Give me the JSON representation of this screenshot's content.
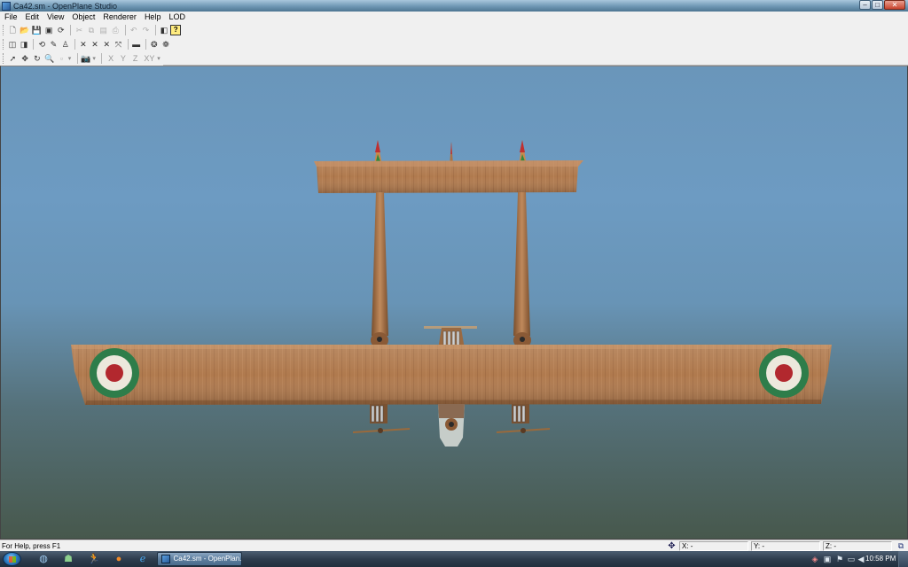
{
  "window": {
    "title": "Ca42.sm - OpenPlane Studio",
    "controls": {
      "minimize": "–",
      "maximize": "□",
      "close": "✕"
    }
  },
  "menubar": {
    "items": [
      "File",
      "Edit",
      "View",
      "Object",
      "Renderer",
      "Help",
      "LOD"
    ]
  },
  "toolbar": {
    "row1": [
      {
        "icon": "new-file-icon",
        "glyph": "🗋"
      },
      {
        "icon": "open-folder-icon",
        "glyph": "📂"
      },
      {
        "icon": "save-icon",
        "glyph": "💾"
      },
      {
        "icon": "save-all-icon",
        "glyph": "▣"
      },
      {
        "icon": "refresh-icon",
        "glyph": "⟳"
      },
      {
        "icon": "cut-icon",
        "glyph": "✂"
      },
      {
        "icon": "copy-icon",
        "glyph": "⧉"
      },
      {
        "icon": "paste-icon",
        "glyph": "▤"
      },
      {
        "icon": "print-icon",
        "glyph": "⎙"
      },
      {
        "icon": "undo-icon",
        "glyph": "↶"
      },
      {
        "icon": "redo-icon",
        "glyph": "↷"
      },
      {
        "icon": "properties-icon",
        "glyph": "◧"
      },
      {
        "icon": "help-icon",
        "glyph": "?"
      }
    ],
    "row2": [
      {
        "icon": "import-icon",
        "glyph": "◫"
      },
      {
        "icon": "export-icon",
        "glyph": "◨"
      },
      {
        "icon": "rotate-tool-icon",
        "glyph": "⟲"
      },
      {
        "icon": "paint-icon",
        "glyph": "✎"
      },
      {
        "icon": "stamp-icon",
        "glyph": "♙"
      },
      {
        "icon": "cross-x-icon",
        "glyph": "✕"
      },
      {
        "icon": "cross-y-icon",
        "glyph": "✕"
      },
      {
        "icon": "cross-z-icon",
        "glyph": "✕"
      },
      {
        "icon": "link-icon",
        "glyph": "⤧"
      },
      {
        "icon": "bar-icon",
        "glyph": "▬"
      },
      {
        "icon": "group-icon",
        "glyph": "❂"
      },
      {
        "icon": "ungroup-icon",
        "glyph": "❁"
      }
    ],
    "row3": [
      {
        "icon": "select-arrow-icon",
        "glyph": "➚"
      },
      {
        "icon": "move-icon",
        "glyph": "✥"
      },
      {
        "icon": "rotate-icon",
        "glyph": "↻"
      },
      {
        "icon": "zoom-icon",
        "glyph": "🔍"
      },
      {
        "icon": "scale-icon",
        "glyph": "▫"
      }
    ],
    "axes": [
      "X",
      "Y",
      "Z",
      "XY"
    ]
  },
  "statusbar": {
    "help_text": "For Help, press F1",
    "x_label": "X: -",
    "y_label": "Y: -",
    "z_label": "Z: -"
  },
  "taskbar": {
    "task_label": "Ca42.sm - OpenPlan...",
    "clock": "10:58 PM"
  },
  "colors": {
    "wood": "#b07a4e",
    "roundel_outer": "#2e7d4a",
    "roundel_middle": "#ece8dc",
    "roundel_inner": "#b2282e"
  }
}
